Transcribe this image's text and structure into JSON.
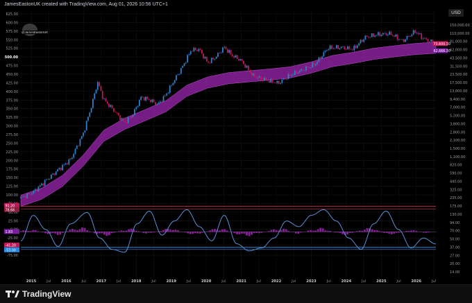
{
  "header": {
    "text": "JamesEastonUK created with TradingView.com, Aug 01, 2026 10:56 UTC+1"
  },
  "avatar": {
    "label": "@JamesEastonUK"
  },
  "currency": "USD",
  "footer": {
    "brand": "TradingView"
  },
  "colors": {
    "bg": "#000000",
    "candle_up": "#2f7fc9",
    "candle_down": "#c2185b",
    "band": "#9c27b0",
    "osc_line": "#5b8fd6",
    "red_line": "#d32f4f",
    "blue_line": "#4a8fe0"
  },
  "chart_data": {
    "type": "line",
    "x_ticks": [
      "2015",
      "Jul",
      "2016",
      "Jul",
      "2017",
      "Jul",
      "2018",
      "Jul",
      "2019",
      "Jul",
      "2020",
      "Jul",
      "2021",
      "Jul",
      "2022",
      "Jul",
      "2023",
      "Jul",
      "2024",
      "Jul",
      "2025",
      "Jul",
      "2026",
      "Jul"
    ],
    "left_axis_ticks": [
      "625.00",
      "600.00",
      "575.00",
      "550.00",
      "525.00",
      "500.00",
      "475.00",
      "450.00",
      "425.00",
      "400.00",
      "375.00",
      "350.00",
      "325.00",
      "300.00",
      "275.00",
      "250.00",
      "225.00",
      "200.00",
      "175.00",
      "150.00",
      "125.00",
      "100.00",
      "75.00",
      "50.00",
      "25.00",
      "0.00",
      "-25.00",
      "-50.00",
      "-75.00"
    ],
    "left_axis_highlight": "500.00",
    "right_axis_ticks": [
      "150,000.00",
      "110,000.00",
      "81,000.00",
      "62,000.00",
      "43,500.00",
      "31,500.00",
      "23,500.00",
      "17,500.00",
      "13,000.00",
      "9,400.00",
      "7,000.00",
      "5,200.00",
      "3,800.00",
      "2,800.00",
      "2,100.00",
      "1,500.00",
      "1,100.00",
      "820.00",
      "590.00",
      "440.00",
      "325.00",
      "235.00",
      "175.00",
      "130.00",
      "94.00",
      "70.00",
      "50.00",
      "37.00",
      "27.00",
      "20.00",
      "14.00"
    ],
    "price_labels": [
      "73,600.30",
      "62,666.30"
    ],
    "osc_labels": [
      "91.20",
      "78.66",
      "1.83",
      "-41.20",
      "-53.00"
    ],
    "price_series": [
      {
        "t": 0.0,
        "v": 225
      },
      {
        "t": 0.03,
        "v": 280
      },
      {
        "t": 0.06,
        "v": 430
      },
      {
        "t": 0.09,
        "v": 650
      },
      {
        "t": 0.12,
        "v": 950
      },
      {
        "t": 0.15,
        "v": 2500
      },
      {
        "t": 0.17,
        "v": 7000
      },
      {
        "t": 0.185,
        "v": 17500
      },
      {
        "t": 0.2,
        "v": 9000
      },
      {
        "t": 0.22,
        "v": 6500
      },
      {
        "t": 0.25,
        "v": 3800
      },
      {
        "t": 0.27,
        "v": 5200
      },
      {
        "t": 0.29,
        "v": 10000
      },
      {
        "t": 0.31,
        "v": 9000
      },
      {
        "t": 0.33,
        "v": 7500
      },
      {
        "t": 0.35,
        "v": 11000
      },
      {
        "t": 0.37,
        "v": 19000
      },
      {
        "t": 0.39,
        "v": 31500
      },
      {
        "t": 0.41,
        "v": 58000
      },
      {
        "t": 0.43,
        "v": 60000
      },
      {
        "t": 0.45,
        "v": 36000
      },
      {
        "t": 0.47,
        "v": 45000
      },
      {
        "t": 0.49,
        "v": 65000
      },
      {
        "t": 0.51,
        "v": 47000
      },
      {
        "t": 0.53,
        "v": 40000
      },
      {
        "t": 0.56,
        "v": 22000
      },
      {
        "t": 0.59,
        "v": 19000
      },
      {
        "t": 0.62,
        "v": 16800
      },
      {
        "t": 0.65,
        "v": 23000
      },
      {
        "t": 0.68,
        "v": 28000
      },
      {
        "t": 0.71,
        "v": 35000
      },
      {
        "t": 0.74,
        "v": 63000
      },
      {
        "t": 0.77,
        "v": 65000
      },
      {
        "t": 0.8,
        "v": 60000
      },
      {
        "t": 0.83,
        "v": 95000
      },
      {
        "t": 0.86,
        "v": 105000
      },
      {
        "t": 0.89,
        "v": 108000
      },
      {
        "t": 0.92,
        "v": 82000
      },
      {
        "t": 0.95,
        "v": 118000
      },
      {
        "t": 0.97,
        "v": 90000
      },
      {
        "t": 1.0,
        "v": 73600
      }
    ],
    "band_series": [
      {
        "t": 0.0,
        "v": 200
      },
      {
        "t": 0.05,
        "v": 260
      },
      {
        "t": 0.1,
        "v": 420
      },
      {
        "t": 0.15,
        "v": 900
      },
      {
        "t": 0.2,
        "v": 2300
      },
      {
        "t": 0.25,
        "v": 3600
      },
      {
        "t": 0.3,
        "v": 5000
      },
      {
        "t": 0.35,
        "v": 7000
      },
      {
        "t": 0.4,
        "v": 12500
      },
      {
        "t": 0.45,
        "v": 17000
      },
      {
        "t": 0.5,
        "v": 20000
      },
      {
        "t": 0.55,
        "v": 21500
      },
      {
        "t": 0.6,
        "v": 23000
      },
      {
        "t": 0.65,
        "v": 25000
      },
      {
        "t": 0.7,
        "v": 30000
      },
      {
        "t": 0.75,
        "v": 38000
      },
      {
        "t": 0.8,
        "v": 43000
      },
      {
        "t": 0.85,
        "v": 50000
      },
      {
        "t": 0.9,
        "v": 55000
      },
      {
        "t": 0.95,
        "v": 60000
      },
      {
        "t": 1.0,
        "v": 63000
      }
    ],
    "osc_series": [
      {
        "t": 0.0,
        "v": -30
      },
      {
        "t": 0.03,
        "v": 60
      },
      {
        "t": 0.06,
        "v": 10
      },
      {
        "t": 0.09,
        "v": -50
      },
      {
        "t": 0.12,
        "v": 30
      },
      {
        "t": 0.16,
        "v": 70
      },
      {
        "t": 0.19,
        "v": -20
      },
      {
        "t": 0.22,
        "v": -60
      },
      {
        "t": 0.25,
        "v": -70
      },
      {
        "t": 0.28,
        "v": 30
      },
      {
        "t": 0.31,
        "v": 75
      },
      {
        "t": 0.34,
        "v": -10
      },
      {
        "t": 0.37,
        "v": 40
      },
      {
        "t": 0.4,
        "v": 80
      },
      {
        "t": 0.43,
        "v": 20
      },
      {
        "t": 0.46,
        "v": -30
      },
      {
        "t": 0.49,
        "v": 60
      },
      {
        "t": 0.52,
        "v": -40
      },
      {
        "t": 0.55,
        "v": -65
      },
      {
        "t": 0.58,
        "v": -55
      },
      {
        "t": 0.61,
        "v": -20
      },
      {
        "t": 0.64,
        "v": 40
      },
      {
        "t": 0.67,
        "v": 20
      },
      {
        "t": 0.7,
        "v": 60
      },
      {
        "t": 0.73,
        "v": 80
      },
      {
        "t": 0.76,
        "v": 40
      },
      {
        "t": 0.79,
        "v": -20
      },
      {
        "t": 0.82,
        "v": -60
      },
      {
        "t": 0.85,
        "v": 30
      },
      {
        "t": 0.88,
        "v": 75
      },
      {
        "t": 0.91,
        "v": 10
      },
      {
        "t": 0.94,
        "v": -55
      },
      {
        "t": 0.97,
        "v": -20
      },
      {
        "t": 1.0,
        "v": -41
      }
    ],
    "hist_series": [
      5,
      10,
      -8,
      -15,
      12,
      20,
      -10,
      -18,
      8,
      15,
      -12,
      6,
      18,
      -5,
      -14,
      10,
      16,
      -8,
      -20,
      -6,
      10,
      14,
      -10,
      8,
      18,
      -4,
      -16,
      10,
      20,
      -12,
      -8,
      12,
      -6,
      2
    ],
    "ref_levels": {
      "upper": 91.2,
      "mid": 1.83,
      "lower": -53.0
    }
  }
}
